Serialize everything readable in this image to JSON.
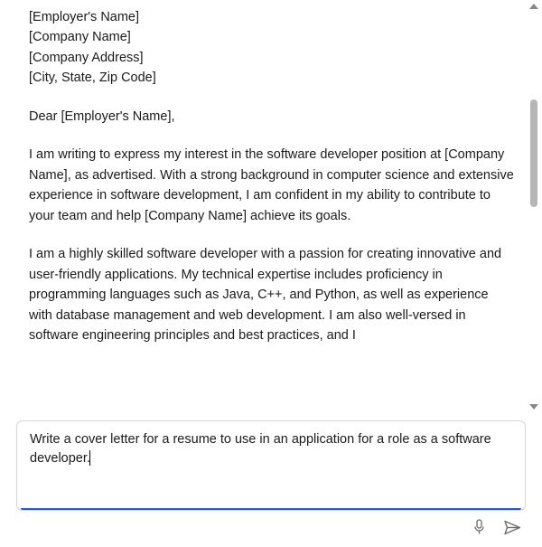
{
  "response": {
    "addressee_block": "[Employer's Name]\n[Company Name]\n[Company Address]\n[City, State, Zip Code]",
    "salutation": "Dear [Employer's Name],",
    "paragraph1": "I am writing to express my interest in the software developer position at [Company Name], as advertised. With a strong background in computer science and extensive experience in software development, I am confident in my ability to contribute to your team and help [Company Name] achieve its goals.",
    "paragraph2": "I am a highly skilled software developer with a passion for creating innovative and user-friendly applications. My technical expertise includes proficiency in programming languages such as Java, C++, and Python, as well as experience with database management and web development. I am also well-versed in software engineering principles and best practices, and I"
  },
  "input": {
    "value": "Write a cover letter for a resume to use in an application for a role as a software developer."
  },
  "scrollbar": {
    "thumb_top_pct": 22,
    "thumb_height_pct": 28
  },
  "colors": {
    "progress": "#1a5fd0",
    "scroll_thumb": "#b6b6b6"
  }
}
